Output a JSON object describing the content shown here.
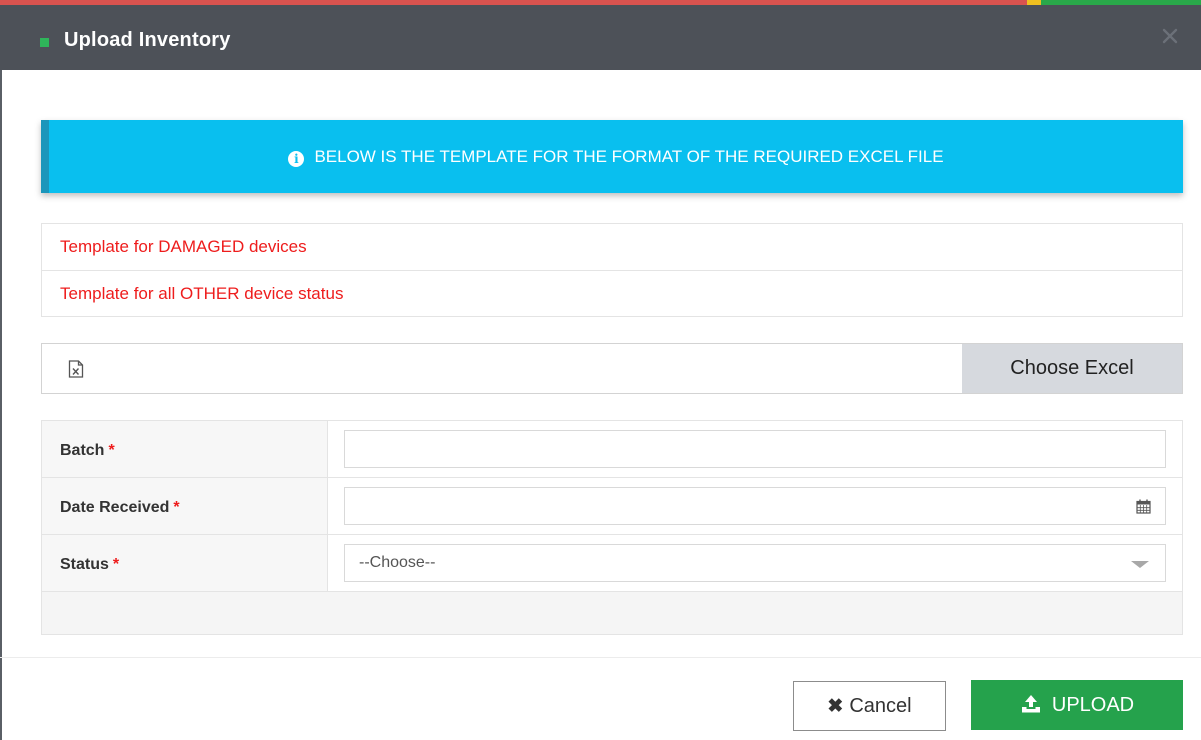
{
  "colors": {
    "header_bg": "#4d5158",
    "header_accent": "#2fb55a",
    "alert_bg": "#09bfef",
    "link_red": "#ee1c1c",
    "upload_green": "#25a24c"
  },
  "modal": {
    "title": "Upload Inventory",
    "close_icon": "close-icon"
  },
  "alert": {
    "icon": "info-icon",
    "text": "BELOW IS THE TEMPLATE FOR THE FORMAT OF THE REQUIRED EXCEL FILE"
  },
  "templates": [
    {
      "label": "Template for DAMAGED devices"
    },
    {
      "label": "Template for all OTHER device status"
    }
  ],
  "file_picker": {
    "icon": "excel-file-icon",
    "button_label": "Choose Excel"
  },
  "form": {
    "required_marker": "*",
    "fields": [
      {
        "label": "Batch",
        "value": ""
      },
      {
        "label": "Date Received",
        "value": "",
        "icon": "calendar-icon"
      },
      {
        "label": "Status",
        "value": "--Choose--",
        "icon": "caret-down-icon"
      }
    ]
  },
  "footer": {
    "cancel_label": "Cancel",
    "upload_label": "UPLOAD"
  }
}
